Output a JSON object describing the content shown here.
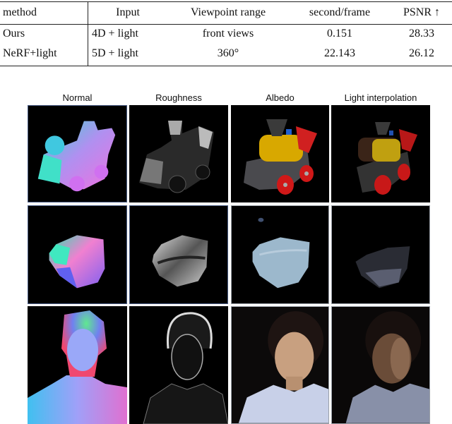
{
  "table": {
    "headers": [
      "method",
      "Input",
      "Viewpoint range",
      "second/frame",
      "PSNR ↑"
    ],
    "rows": [
      [
        "Ours",
        "4D + light",
        "front views",
        "0.151",
        "28.33"
      ],
      [
        "NeRF+light",
        "5D + light",
        "360°",
        "22.143",
        "26.12"
      ]
    ]
  },
  "figure": {
    "column_labels": [
      "Normal",
      "Roughness",
      "Albedo",
      "Light interpolation"
    ],
    "rows": [
      {
        "subject": "toy train",
        "panels": [
          "train-normal",
          "train-roughness",
          "train-albedo",
          "train-light-interpolation"
        ]
      },
      {
        "subject": "face mask",
        "panels": [
          "mask-normal",
          "mask-roughness",
          "mask-albedo",
          "mask-light-interpolation"
        ]
      },
      {
        "subject": "woman portrait",
        "panels": [
          "person-normal",
          "person-roughness",
          "person-albedo",
          "person-light-interpolation"
        ]
      }
    ]
  }
}
